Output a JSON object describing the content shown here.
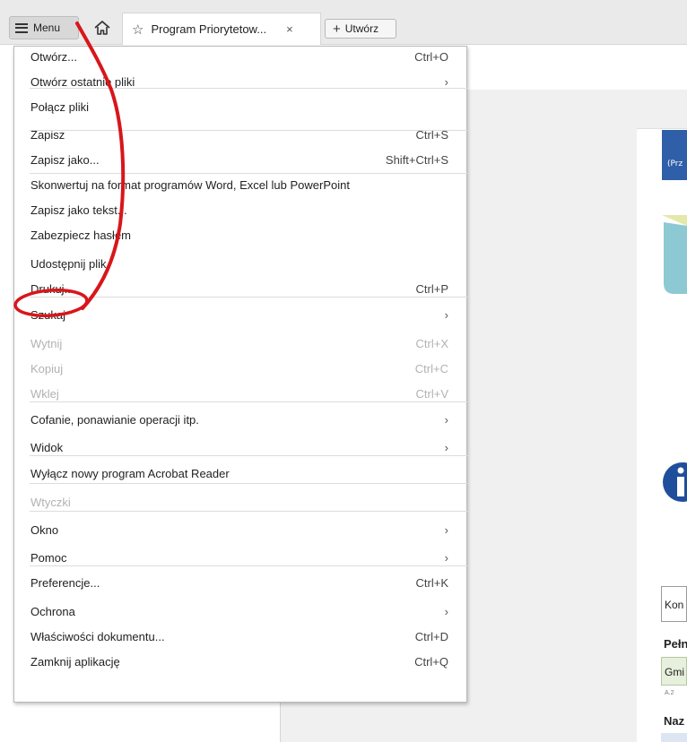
{
  "toolbar": {
    "menu_label": "Menu",
    "tab_title": "Program Priorytetow...",
    "tab_close": "×",
    "create_label": "Utwórz"
  },
  "menu": {
    "items": [
      {
        "label": "Otwórz...",
        "shortcut": "Ctrl+O",
        "submenu": false,
        "disabled": false
      },
      {
        "label": "Otwórz ostatnie pliki",
        "shortcut": "",
        "submenu": true,
        "disabled": false
      },
      {
        "label": "Połącz pliki",
        "shortcut": "",
        "submenu": false,
        "disabled": false
      },
      {
        "label": "Zapisz",
        "shortcut": "Ctrl+S",
        "submenu": false,
        "disabled": false
      },
      {
        "label": "Zapisz jako...",
        "shortcut": "Shift+Ctrl+S",
        "submenu": false,
        "disabled": false
      },
      {
        "label": "Skonwertuj na format programów Word, Excel lub PowerPoint",
        "shortcut": "",
        "submenu": false,
        "disabled": false
      },
      {
        "label": "Zapisz jako tekst...",
        "shortcut": "",
        "submenu": false,
        "disabled": false
      },
      {
        "label": "Zabezpiecz hasłem",
        "shortcut": "",
        "submenu": false,
        "disabled": false
      },
      {
        "label": "Udostępnij plik",
        "shortcut": "",
        "submenu": false,
        "disabled": false
      },
      {
        "label": "Drukuj...",
        "shortcut": "Ctrl+P",
        "submenu": false,
        "disabled": false
      },
      {
        "label": "Szukaj",
        "shortcut": "",
        "submenu": true,
        "disabled": false
      },
      {
        "label": "Wytnij",
        "shortcut": "Ctrl+X",
        "submenu": false,
        "disabled": true
      },
      {
        "label": "Kopiuj",
        "shortcut": "Ctrl+C",
        "submenu": false,
        "disabled": true
      },
      {
        "label": "Wklej",
        "shortcut": "Ctrl+V",
        "submenu": false,
        "disabled": true
      },
      {
        "label": "Cofanie, ponawianie operacji itp.",
        "shortcut": "",
        "submenu": true,
        "disabled": false
      },
      {
        "label": "Widok",
        "shortcut": "",
        "submenu": true,
        "disabled": false
      },
      {
        "label": "Wyłącz nowy program Acrobat Reader",
        "shortcut": "",
        "submenu": false,
        "disabled": false
      },
      {
        "label": "Wtyczki",
        "shortcut": "",
        "submenu": false,
        "disabled": true
      },
      {
        "label": "Okno",
        "shortcut": "",
        "submenu": true,
        "disabled": false
      },
      {
        "label": "Pomoc",
        "shortcut": "",
        "submenu": true,
        "disabled": false
      },
      {
        "label": "Preferencje...",
        "shortcut": "Ctrl+K",
        "submenu": false,
        "disabled": false
      },
      {
        "label": "Ochrona",
        "shortcut": "",
        "submenu": true,
        "disabled": false
      },
      {
        "label": "Właściwości dokumentu...",
        "shortcut": "Ctrl+D",
        "submenu": false,
        "disabled": false
      },
      {
        "label": "Zamknij aplikację",
        "shortcut": "Ctrl+Q",
        "submenu": false,
        "disabled": false
      }
    ],
    "arrow_glyph": "›"
  },
  "document": {
    "blue_header_text": "(Prz",
    "field_1": "Kon",
    "heading_1": "Pełn",
    "green_field": "Gmi",
    "small_label": "A.2",
    "heading_2": "Naz"
  },
  "colors": {
    "annotation": "#d8161b",
    "header_blue": "#2f5fa8",
    "info_blue": "#1f4f9c"
  }
}
